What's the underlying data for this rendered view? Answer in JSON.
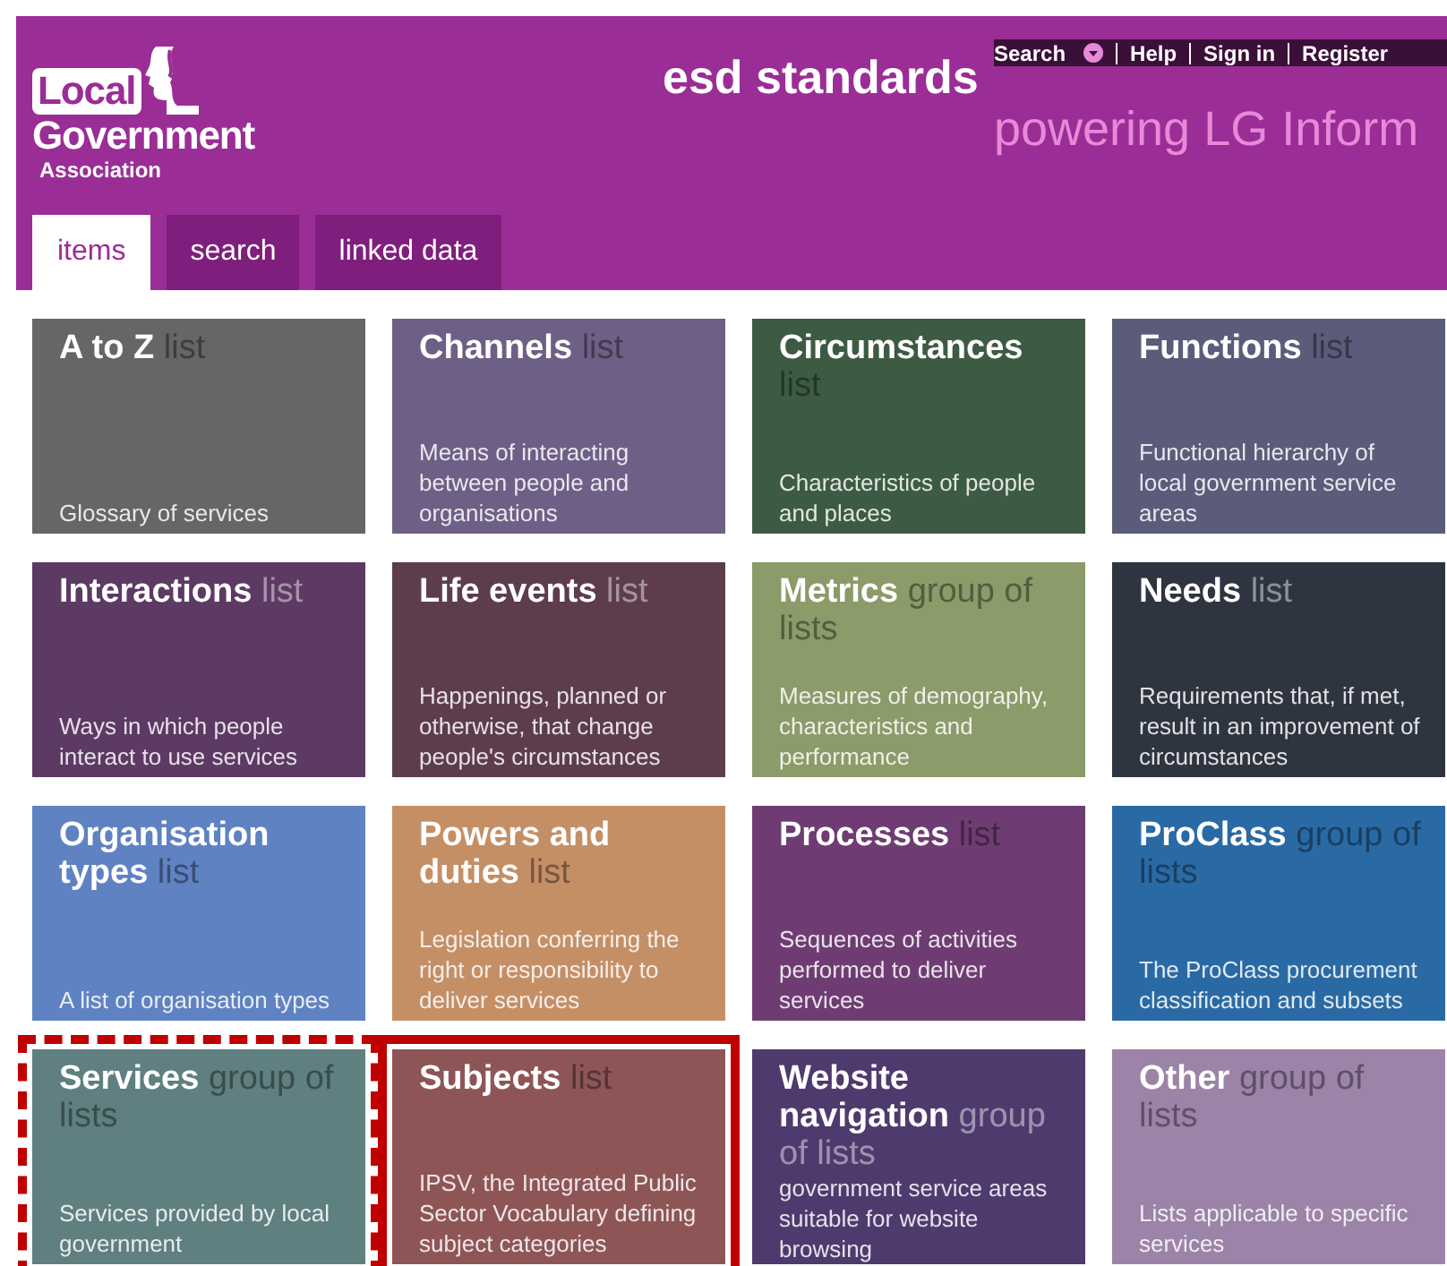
{
  "header": {
    "logo": {
      "word": "Local",
      "line2": "Government",
      "line3": "Association"
    },
    "title": "esd standards",
    "tagline": "powering LG Inform",
    "top_links": [
      {
        "label": "Search",
        "dropdown": true
      },
      {
        "label": "Help",
        "dropdown": false
      },
      {
        "label": "Sign in",
        "dropdown": false
      },
      {
        "label": "Register",
        "dropdown": false
      }
    ],
    "tabs": [
      {
        "label": "items",
        "selected": true
      },
      {
        "label": "search",
        "selected": false
      },
      {
        "label": "linked data",
        "selected": false
      }
    ]
  },
  "cards": [
    {
      "title": "A to Z",
      "suffix": "list",
      "description": "Glossary of services",
      "color": "#666666",
      "dashed_frame": false,
      "solid_frame": false
    },
    {
      "title": "Channels",
      "suffix": "list",
      "description": "Means of interacting between people and organisations",
      "color": "#6e5f86",
      "dashed_frame": false,
      "solid_frame": false
    },
    {
      "title": "Circumstances",
      "suffix": "list",
      "description": "Characteristics of people and places",
      "color": "#3d5b43",
      "dashed_frame": false,
      "solid_frame": false
    },
    {
      "title": "Functions",
      "suffix": "list",
      "description": "Functional hierarchy of local government service areas",
      "color": "#5b5c7a",
      "dashed_frame": false,
      "solid_frame": false
    },
    {
      "title": "Interactions",
      "suffix": "list",
      "description": "Ways in which people interact to use services",
      "color": "#5c3a63",
      "dashed_frame": false,
      "solid_frame": false
    },
    {
      "title": "Life events",
      "suffix": "list",
      "description": "Happenings, planned or otherwise, that change people's circumstances",
      "color": "#5d3d4c",
      "dashed_frame": false,
      "solid_frame": false
    },
    {
      "title": "Metrics",
      "suffix": "group of lists",
      "description": "Measures of demography, characteristics and performance",
      "color": "#8b9b69",
      "dashed_frame": false,
      "solid_frame": false
    },
    {
      "title": "Needs",
      "suffix": "list",
      "description": "Requirements that, if met, result in an improvement of circumstances",
      "color": "#2e3440",
      "dashed_frame": false,
      "solid_frame": false
    },
    {
      "title": "Organisation types",
      "suffix": "list",
      "description": "A list of organisation types",
      "color": "#5f82c2",
      "dashed_frame": false,
      "solid_frame": false
    },
    {
      "title": "Powers and duties",
      "suffix": "list",
      "description": "Legislation conferring the right or responsibility to deliver services",
      "color": "#c58f66",
      "dashed_frame": false,
      "solid_frame": false
    },
    {
      "title": "Processes",
      "suffix": "list",
      "description": "Sequences of activities performed to deliver services",
      "color": "#6e3c72",
      "dashed_frame": false,
      "solid_frame": false
    },
    {
      "title": "ProClass",
      "suffix": "group of lists",
      "description": "The ProClass procurement classification and subsets",
      "color": "#2a6aa4",
      "dashed_frame": false,
      "solid_frame": false
    },
    {
      "title": "Services",
      "suffix": "group of lists",
      "description": "Services provided by local government",
      "color": "#5f7f80",
      "dashed_frame": true,
      "solid_frame": false
    },
    {
      "title": "Subjects",
      "suffix": "list",
      "description": "IPSV, the Integrated Public Sector Vocabulary defining subject categories",
      "color": "#8e5557",
      "dashed_frame": false,
      "solid_frame": true
    },
    {
      "title": "Website navigation",
      "suffix": "group of lists",
      "description": "government service areas suitable for website browsing",
      "color": "#4f3a6e",
      "dashed_frame": false,
      "solid_frame": false
    },
    {
      "title": "Other",
      "suffix": "group of lists",
      "description": "Lists applicable to specific services",
      "color": "#9b84a8",
      "dashed_frame": false,
      "solid_frame": false
    }
  ]
}
